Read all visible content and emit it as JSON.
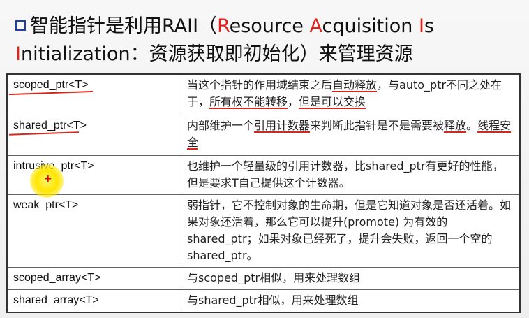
{
  "title": {
    "line1_prefix": "智能指针是利用RAII（",
    "r": "R",
    "word_esource": "esource ",
    "a": "A",
    "word_cquisition": "cquisition ",
    "i": "I",
    "word_s": "s",
    "i2": "I",
    "line2_rest": "nitialization：资源获取即初始化）来管理资源"
  },
  "rows": [
    {
      "name": "scoped_ptr<T>",
      "desc_parts": [
        "当这个指针的作用域结束之后",
        "自动释放",
        "，与auto_ptr不同之处在于，",
        "所有权不能转移",
        "，",
        "但是可以交换"
      ]
    },
    {
      "name": "shared_ptr<T>",
      "desc_parts": [
        "内部维护一个",
        "引用计数器",
        "来判断此指针是不是需要被",
        "释放",
        "。",
        "线程安全"
      ]
    },
    {
      "name": "intrusive_ptr<T>",
      "desc": "也维护一个轻量级的引用计数器，比shared_ptr有更好的性能，但是要求T自己提供这个计数器。"
    },
    {
      "name": "weak_ptr<T>",
      "desc": "弱指针，它不控制对象的生命期，但是它知道对象是否还活着。如果对象还活着，那么它可以提升(promote) 为有效的 shared_ptr；如果对象已经死了，提升会失败，返回一个空的 shared_ptr。"
    },
    {
      "name": "scoped_array<T>",
      "desc": "与scoped_ptr相似，用来处理数组"
    },
    {
      "name": "shared_array<T>",
      "desc": "与shared_ptr相似，用来处理数组"
    }
  ],
  "colors": {
    "accent_red": "#e1221b",
    "bullet_blue": "#1f3fa8"
  }
}
